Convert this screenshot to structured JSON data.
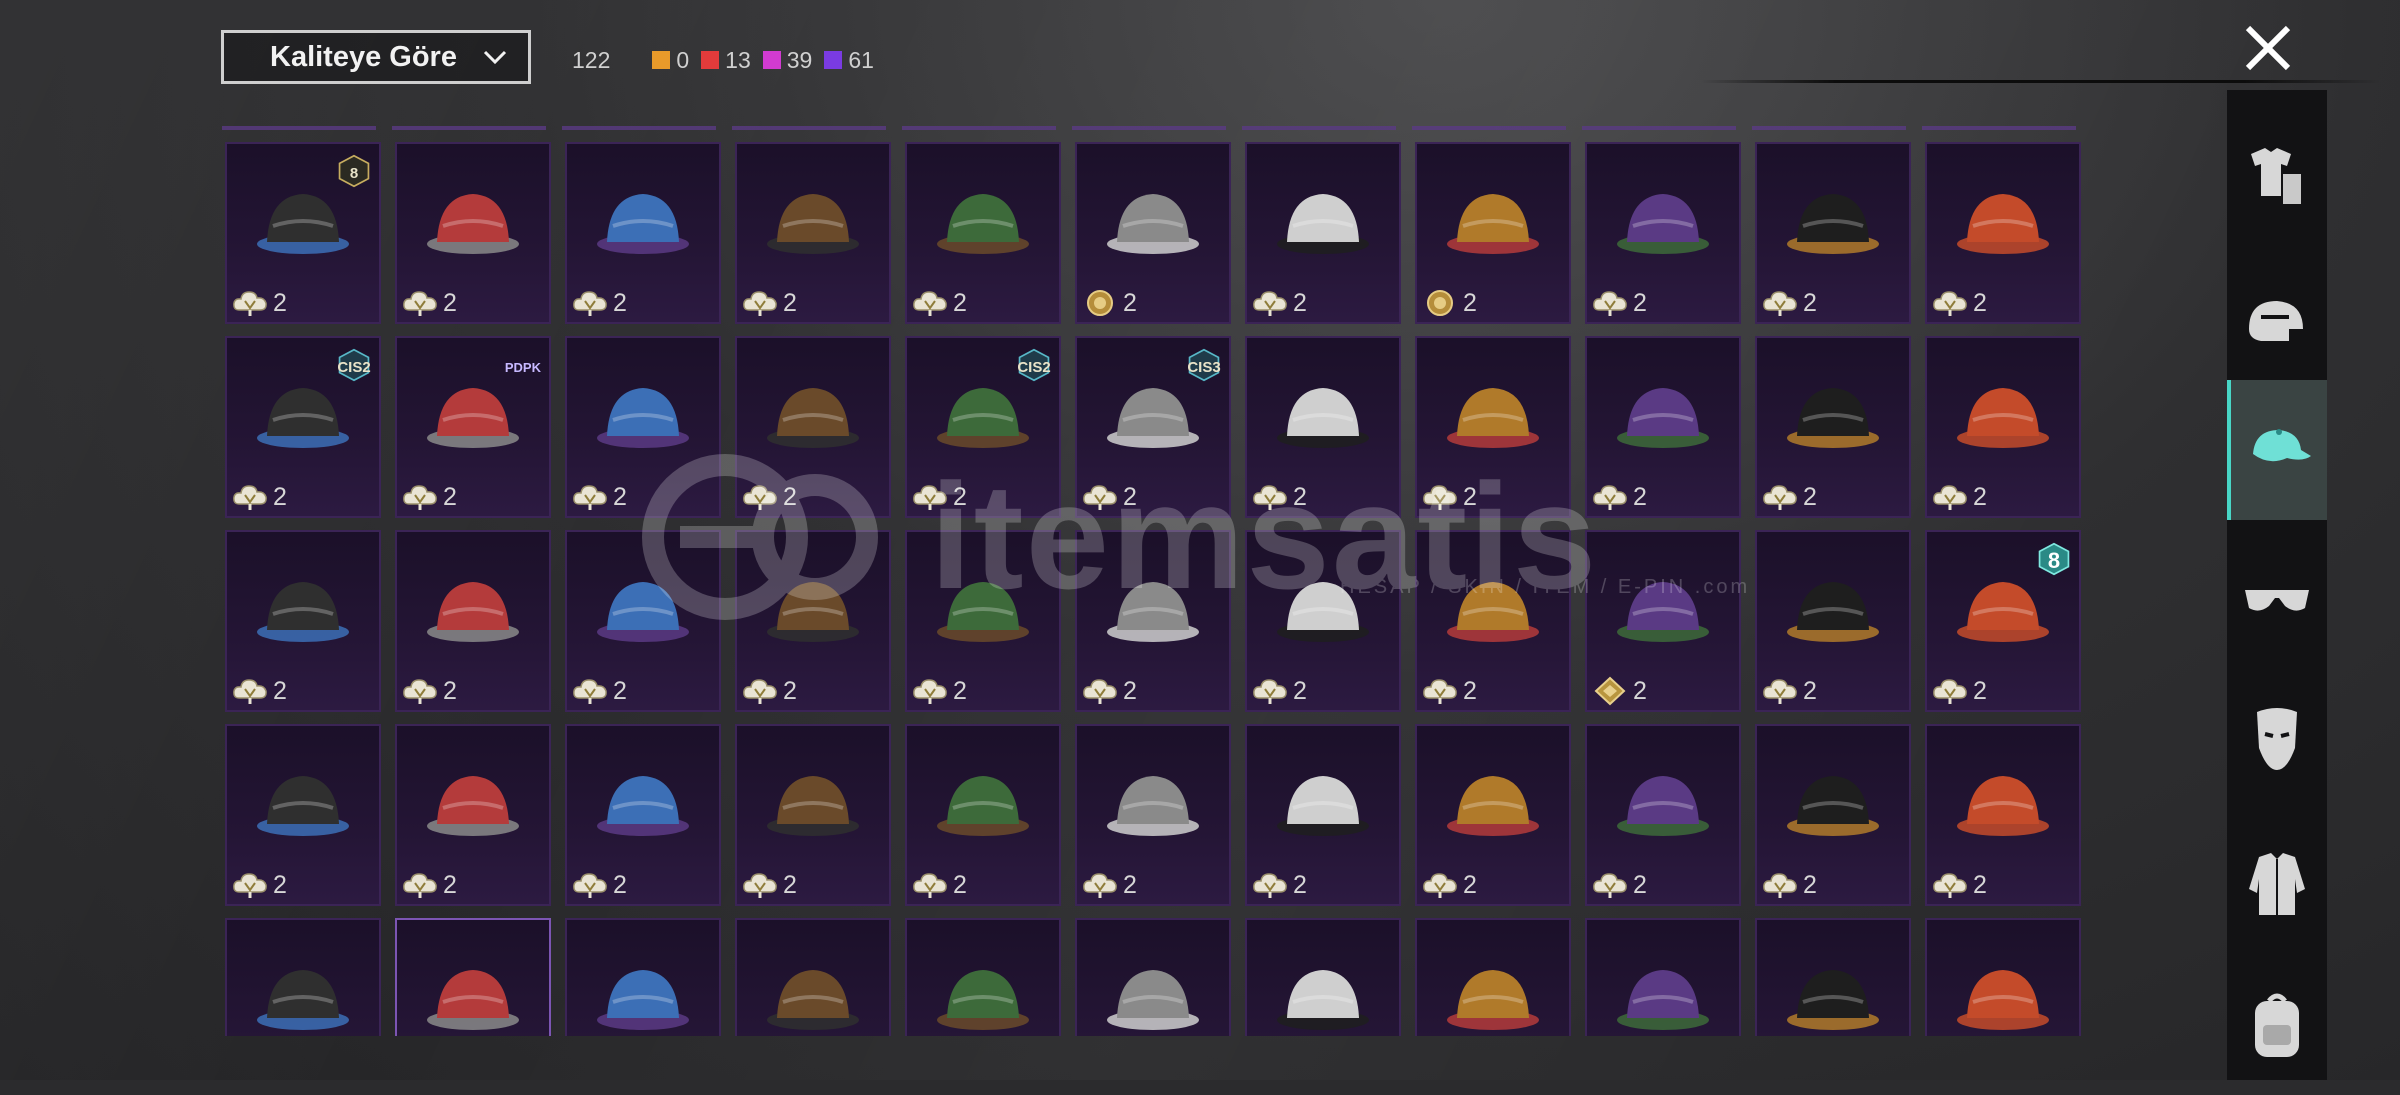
{
  "sort": {
    "label": "Kaliteye Göre"
  },
  "counts": {
    "total": "122",
    "tiers": [
      {
        "color": "#e89a2a",
        "value": "0"
      },
      {
        "color": "#e23b3b",
        "value": "13"
      },
      {
        "color": "#d13bd1",
        "value": "39"
      },
      {
        "color": "#7a3be2",
        "value": "61"
      }
    ]
  },
  "watermark": {
    "text": "itemsatis",
    "sub": "HESAP / SKIN / İTEM / E-PIN .com"
  },
  "sidebar": {
    "items": [
      {
        "name": "outfit-icon",
        "active": false
      },
      {
        "name": "helmet-icon",
        "active": false
      },
      {
        "name": "cap-icon",
        "active": true
      },
      {
        "name": "glasses-icon",
        "active": false
      },
      {
        "name": "mask-icon",
        "active": false
      },
      {
        "name": "jacket-icon",
        "active": false
      },
      {
        "name": "backpack-icon",
        "active": false
      }
    ]
  },
  "items": [
    {
      "icon": "green-skull-hood-icon",
      "count": "2",
      "badge": "8",
      "badgeType": "gold",
      "currency": "cloud"
    },
    {
      "icon": "blue-baseball-cap-icon",
      "count": "2",
      "currency": "cloud"
    },
    {
      "icon": "black-helmet-icon",
      "count": "2",
      "currency": "cloud"
    },
    {
      "icon": "aviator-goggles-hat-icon",
      "count": "2",
      "currency": "cloud"
    },
    {
      "icon": "purple-bunny-hat-icon",
      "count": "2",
      "currency": "cloud"
    },
    {
      "icon": "red-pigtails-bow-icon",
      "count": "2",
      "currency": "coin"
    },
    {
      "icon": "red-white-cap-icon",
      "count": "2",
      "currency": "cloud"
    },
    {
      "icon": "white-sun-hat-icon",
      "count": "2",
      "currency": "coin"
    },
    {
      "icon": "orange-beanie-hair-icon",
      "count": "2",
      "currency": "cloud"
    },
    {
      "icon": "black-snapback-icon",
      "count": "2",
      "currency": "cloud"
    },
    {
      "icon": "red-fez-icon",
      "count": "2",
      "currency": "cloud"
    },
    {
      "icon": "striped-bandana-icon",
      "count": "2",
      "badge": "CIS2",
      "badgeType": "cis",
      "currency": "cloud"
    },
    {
      "icon": "silver-bob-hair-icon",
      "count": "2",
      "badge": "PDPK",
      "badgeType": "pop",
      "currency": "cloud"
    },
    {
      "icon": "horse-head-icon",
      "count": "2",
      "currency": "cloud"
    },
    {
      "icon": "green-helmet-icon",
      "count": "2",
      "currency": "cloud"
    },
    {
      "icon": "chef-hat-gasmask-icon",
      "count": "2",
      "badge": "CIS2",
      "badgeType": "cis",
      "currency": "cloud"
    },
    {
      "icon": "robot-dog-head-icon",
      "count": "2",
      "badge": "CIS3",
      "badgeType": "cis",
      "currency": "cloud"
    },
    {
      "icon": "red-mohawk-icon",
      "count": "2",
      "currency": "cloud"
    },
    {
      "icon": "red-motorcycle-helmet-icon",
      "count": "2",
      "currency": "cloud"
    },
    {
      "icon": "blue-cricket-helmet-icon",
      "count": "2",
      "currency": "cloud"
    },
    {
      "icon": "tribal-mask-helmet-icon",
      "count": "2",
      "currency": "cloud"
    },
    {
      "icon": "black-bob-hair-icon",
      "count": "2",
      "currency": "cloud"
    },
    {
      "icon": "navy-cap-icon",
      "count": "2",
      "currency": "cloud"
    },
    {
      "icon": "black-gasmask-hood-icon",
      "count": "2",
      "currency": "cloud"
    },
    {
      "icon": "goggles-helmet-icon",
      "count": "2",
      "currency": "cloud"
    },
    {
      "icon": "mustard-beanie-icon",
      "count": "2",
      "currency": "cloud"
    },
    {
      "icon": "white-red-headband-icon",
      "count": "2",
      "currency": "cloud"
    },
    {
      "icon": "white-turban-icon",
      "count": "2",
      "currency": "cloud"
    },
    {
      "icon": "demon-mask-hair-icon",
      "count": "2",
      "currency": "cloud"
    },
    {
      "icon": "bunny-ears-icon",
      "count": "2",
      "currency": "cloud"
    },
    {
      "icon": "black-beanie-icon",
      "count": "2",
      "currency": "diamond"
    },
    {
      "icon": "pirate-hat-icon",
      "count": "2",
      "currency": "cloud"
    },
    {
      "icon": "camo-boonie-hat-icon",
      "count": "2",
      "badge": "8",
      "badgeType": "teal",
      "currency": "cloud"
    },
    {
      "icon": "cat-ear-headphones-icon",
      "count": "2",
      "currency": "cloud"
    },
    {
      "icon": "knit-pompom-hat-icon",
      "count": "2",
      "currency": "cloud"
    },
    {
      "icon": "white-feather-hat-icon",
      "count": "2",
      "currency": "cloud"
    },
    {
      "icon": "jester-mask-icon",
      "count": "2",
      "currency": "cloud"
    },
    {
      "icon": "black-beret-icon",
      "count": "2",
      "currency": "cloud"
    },
    {
      "icon": "luchador-mask-icon",
      "count": "2",
      "currency": "cloud"
    },
    {
      "icon": "shark-hat-icon",
      "count": "2",
      "currency": "cloud"
    },
    {
      "icon": "red-beret-icon",
      "count": "2",
      "currency": "cloud"
    },
    {
      "icon": "black-top-hat-icon",
      "count": "2",
      "currency": "cloud"
    },
    {
      "icon": "red-fedora-icon",
      "count": "2",
      "currency": "cloud"
    },
    {
      "icon": "grey-shark-hat-icon",
      "count": "2",
      "currency": "cloud"
    },
    {
      "icon": "purple-flower-crown-icon",
      "count": "",
      "currency": "none"
    },
    {
      "icon": "red-bucket-hat-icon",
      "count": "",
      "currency": "none",
      "selected": true
    },
    {
      "icon": "cupcake-hat-icon",
      "count": "",
      "currency": "none"
    },
    {
      "icon": "burger-hat-icon",
      "count": "",
      "currency": "none"
    },
    {
      "icon": "doctor-headlamp-icon",
      "count": "",
      "currency": "none"
    },
    {
      "icon": "headband-icon",
      "count": "",
      "currency": "none"
    },
    {
      "icon": "pilot-cap-icon",
      "count": "",
      "currency": "none"
    },
    {
      "icon": "navy-garrison-cap-icon",
      "count": "",
      "currency": "none"
    },
    {
      "icon": "black-logo-cap-icon",
      "count": "",
      "currency": "none"
    },
    {
      "icon": "maroon-fedora-icon",
      "count": "",
      "currency": "none"
    },
    {
      "icon": "plaid-helmet-icon",
      "count": "",
      "currency": "none"
    }
  ]
}
